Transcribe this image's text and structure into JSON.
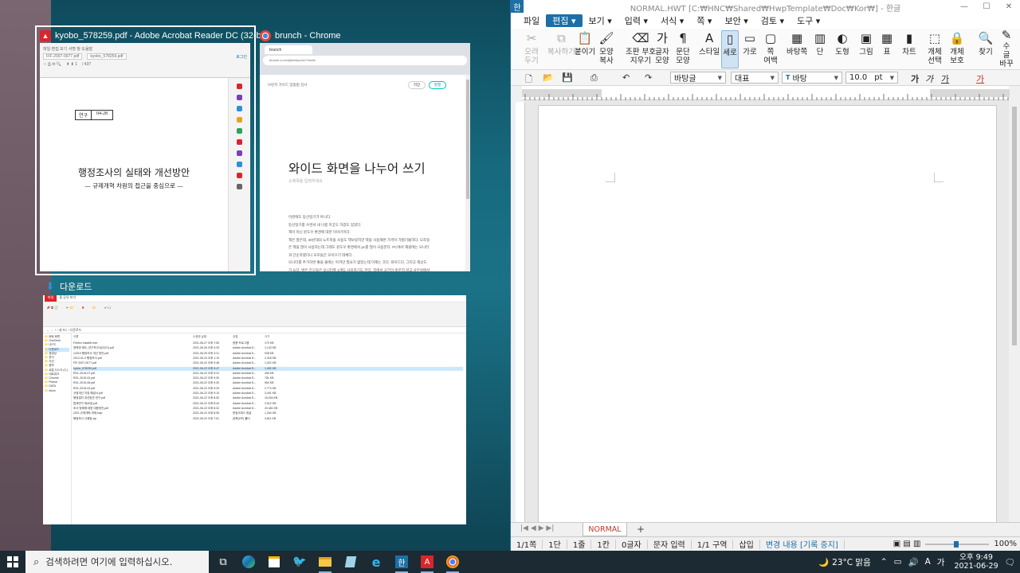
{
  "snap": {
    "acrobat": {
      "title": "kyobo_578259.pdf - Adobe Acrobat Reader DC (32-bit)",
      "tab1": "FIF-2007-0077.pdf",
      "tab2": "kyobo_578259.pdf",
      "page_tag1": "연구",
      "page_tag2": "04-28",
      "doc_title": "행정조사의 실태와 개선방안",
      "doc_subtitle": "— 규제개혁 차원의 접근을 중심으로 —",
      "page_num": "/ 437"
    },
    "chrome": {
      "title": "brunch - Chrome",
      "tab": "brunch",
      "url": "brunch.co.kr/@kimkyoni/17/write",
      "btn_save": "저장",
      "btn_publish": "발행",
      "nav": "브런치 가이드  맞춤법 검사",
      "heading": "와이드 화면을 나누어 쓰기",
      "subheading": "소제목을 입력하세요",
      "body": [
        "이번에도 등산일기가 아니다.",
        "등산일기를 쓰면서 내 나름 미궁도 하겠도 있었다.",
        "책이 아닌 윈도우 환경에 대한 이야기이다.",
        "책은 많은데, 30년대의 노트북을 사용도 책보았지만 책을 사용해본 가격이 가볍기불하다. 모조등",
        "은 책을 많이 사용하는데 그래도 윈도우 환경에서 pc를 많이 사용한다. PC에서 해왔에는 모니터",
        "과 단순하였다니 모조들은 모이므기 대체다.",
        "모니터를 추가하면 좋을 줄에는 아끼만 필요가 없었는데 이제는 크다. 와이드다. 그리고 해상도",
        "가 높다. 발은 친구들은 모니터를 2개도 사용하기도 한다. 집에서 공간이 충분치 않고 사무실에서",
        "이를 지원한다면 문제가 없으나 모니터가 부족하다면 모니터를 나누어서 활용하면 효과적이다."
      ]
    },
    "explorer": {
      "title": "다운로드"
    }
  },
  "explorer_rows": [
    {
      "name": "Firefox Installer.exe",
      "date": "2021-06-27 오후 7:50",
      "type": "응용 프로그램",
      "size": "170 KB"
    },
    {
      "name": "정책과 제도_연구보고서(2021).pdf",
      "date": "2021-06-26 오후 4:33",
      "type": "Adobe Acrobat D...",
      "size": "1,143 KB"
    },
    {
      "name": "12019 행정조사 개선 방안.pdf",
      "date": "2021-06-25 오후 3:21",
      "type": "Adobe Acrobat D...",
      "size": "928 KB"
    },
    {
      "name": "2012-01-0 행정조사.pdf",
      "date": "2021-06-24 오후 1:10",
      "type": "Adobe Acrobat D...",
      "size": "2,418 KB"
    },
    {
      "name": "FIF-2007-0077.pdf",
      "date": "2021-06-22 오후 9:48",
      "type": "Adobe Acrobat D...",
      "size": "1,022 KB"
    },
    {
      "name": "kyobo_578259.pdf",
      "date": "2021-06-22 오후 9:47",
      "type": "Adobe Acrobat D...",
      "size": "1,452 KB"
    },
    {
      "name": "ROL-2015-07.pdf",
      "date": "2021-06-22 오후 9:31",
      "type": "Adobe Acrobat D...",
      "size": "406 KB"
    },
    {
      "name": "ROL-2015-02.pdf",
      "date": "2021-06-22 오후 9:30",
      "type": "Adobe Acrobat D...",
      "size": "781 KB"
    },
    {
      "name": "ROL-2015-06.pdf",
      "date": "2021-06-22 오후 9:30",
      "type": "Adobe Acrobat D...",
      "size": "554 KB"
    },
    {
      "name": "ROL-2016-02.pdf",
      "date": "2021-06-22 오후 9:29",
      "type": "Adobe Acrobat D...",
      "size": "2,774 KB"
    },
    {
      "name": "규정개선 지침 해설서.pdf",
      "date": "2021-06-22 오후 9:10",
      "type": "Adobe Acrobat D...",
      "size": "3,401 KB"
    },
    {
      "name": "행정절차 개선방안 연구.pdf",
      "date": "2021-06-22 오후 8:53",
      "type": "Adobe Acrobat D...",
      "size": "15,264 KB"
    },
    {
      "name": "법제연구 제40호.pdf",
      "date": "2021-06-22 오후 8:44",
      "type": "Adobe Acrobat D...",
      "size": "2,512 KB"
    },
    {
      "name": "조사 방해에 대한 대응방안.pdf",
      "date": "2021-06-22 오후 8:32",
      "type": "Adobe Acrobat D...",
      "size": "20,461 KB"
    },
    {
      "name": "2021 규제개혁 과제.hwp",
      "date": "2021-06-22 오후 8:05",
      "type": "한컴오피스 한글",
      "size": "1,264 KB"
    },
    {
      "name": "행정조사 사례집.zip",
      "date": "2021-06-22 오후 7:51",
      "type": "압축(ZIP) 폴더",
      "size": "3,811 KB"
    }
  ],
  "hwp": {
    "title": "NORMAL.HWT [C:₩HNC₩Shared₩HwpTemplate₩Doc₩Kor₩] - 한글",
    "logo": "한",
    "menu": [
      "파일",
      "편집",
      "보기",
      "입력",
      "서식",
      "쪽",
      "보안",
      "검토",
      "도구"
    ],
    "active_menu": "편집",
    "ribbon": [
      {
        "label": "오려\n두기",
        "icon": "✂",
        "disabled": true
      },
      {
        "label": "복사하기",
        "icon": "⧉",
        "disabled": true
      },
      {
        "label": "붙이기",
        "icon": "📋",
        "disabled": false
      },
      {
        "label": "모양\n복사",
        "icon": "🖌",
        "disabled": false
      },
      {
        "label": "조판 부호\n지우기",
        "icon": "⌫",
        "disabled": false
      },
      {
        "label": "글자\n모양",
        "icon": "가",
        "disabled": false
      },
      {
        "label": "문단\n모양",
        "icon": "¶",
        "disabled": false
      },
      {
        "label": "스타일",
        "icon": "A",
        "disabled": false
      },
      {
        "label": "세로",
        "icon": "▯",
        "disabled": false
      },
      {
        "label": "가로",
        "icon": "▭",
        "disabled": false
      },
      {
        "label": "쪽\n여백",
        "icon": "▢",
        "disabled": false
      },
      {
        "label": "바탕쪽",
        "icon": "▦",
        "disabled": false
      },
      {
        "label": "단",
        "icon": "▥",
        "disabled": false
      },
      {
        "label": "도형",
        "icon": "◐",
        "disabled": false
      },
      {
        "label": "그림",
        "icon": "▣",
        "disabled": false
      },
      {
        "label": "표",
        "icon": "▦",
        "disabled": false
      },
      {
        "label": "차트",
        "icon": "▮",
        "disabled": false
      },
      {
        "label": "개체\n선택",
        "icon": "⬚",
        "disabled": false
      },
      {
        "label": "개체\n보호",
        "icon": "🔒",
        "disabled": false
      },
      {
        "label": "찾기",
        "icon": "🔍",
        "disabled": false
      },
      {
        "label": "수\n글\n바꾸",
        "icon": "✎",
        "disabled": false
      }
    ],
    "style_combo": "바탕글",
    "lang_combo": "대표",
    "font_combo": "바탕",
    "size_combo": "10.0",
    "size_unit": "pt",
    "tab_name": "NORMAL",
    "status": [
      "1/1쪽",
      "1단",
      "1줄",
      "1칸",
      "0글자",
      "문자 입력",
      "1/1 구역",
      "삽입",
      "변경 내용 [기록 중지]"
    ],
    "zoom": "100%"
  },
  "taskbar": {
    "search_placeholder": "검색하려면 여기에 입력하십시오.",
    "weather": "23°C 맑음",
    "lang": "A",
    "ime": "가",
    "time": "오후 9:49",
    "date": "2021-06-29"
  }
}
